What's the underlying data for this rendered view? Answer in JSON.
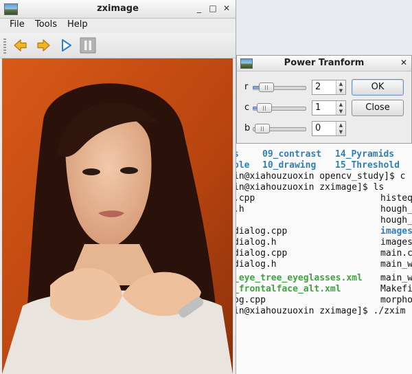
{
  "main_window": {
    "title": "zximage",
    "minimize_glyph": "_",
    "maximize_glyph": "□",
    "close_glyph": "✕",
    "menu": [
      "File",
      "Tools",
      "Help"
    ],
    "toolbar": [
      {
        "name": "back-arrow-icon",
        "color": "#e9a51b"
      },
      {
        "name": "forward-arrow-icon",
        "color": "#e9a51b"
      },
      {
        "name": "play-icon",
        "color": "#2a7fd0"
      },
      {
        "name": "pause-icon",
        "color": "#9a9a9a"
      }
    ]
  },
  "dialog": {
    "title": "Power Tranform",
    "close_glyph": "✕",
    "params": [
      {
        "label": "r",
        "value": "2"
      },
      {
        "label": "c",
        "value": "1"
      },
      {
        "label": "b",
        "value": "0"
      }
    ],
    "ok_label": "OK",
    "close_label": "Close"
  },
  "terminal": {
    "lines": [
      [
        {
          "text": "s",
          "color": "blue"
        },
        {
          "text": "09_contrast",
          "color": "blue"
        },
        {
          "text": "14_Pyramids",
          "color": "blue"
        }
      ],
      [
        {
          "text": "ole",
          "color": "blue"
        },
        {
          "text": "10_drawing",
          "color": "blue"
        },
        {
          "text": "15_Threshold",
          "color": "blue"
        }
      ],
      [
        {
          "text": "in@xiahouzuoxin opencv_study]$ c",
          "color": "plain"
        }
      ],
      [
        {
          "text": "in@xiahouzuoxin zximage]$ ls",
          "color": "plain"
        }
      ],
      [
        {
          "text": ".cpp",
          "color": "plain"
        },
        {
          "text": "histeq",
          "color": "plain"
        }
      ],
      [
        {
          "text": ".h",
          "color": "plain"
        },
        {
          "text": "hough_",
          "color": "plain"
        }
      ],
      [
        {
          "text": "hough_",
          "color": "plain"
        }
      ],
      [
        {
          "text": "dialog.cpp",
          "color": "plain"
        },
        {
          "text": "images",
          "color": "blue"
        }
      ],
      [
        {
          "text": "dialog.h",
          "color": "plain"
        },
        {
          "text": "images",
          "color": "plain"
        }
      ],
      [
        {
          "text": "dialog.cpp",
          "color": "plain"
        },
        {
          "text": "main.c",
          "color": "plain"
        }
      ],
      [
        {
          "text": "dialog.h",
          "color": "plain"
        },
        {
          "text": "main_w",
          "color": "plain"
        }
      ],
      [
        {
          "text": "_eye_tree_eyeglasses.xml",
          "color": "green"
        },
        {
          "text": "main_w",
          "color": "plain"
        }
      ],
      [
        {
          "text": "_frontalface_alt.xml",
          "color": "green"
        },
        {
          "text": "Makefi",
          "color": "plain"
        }
      ],
      [
        {
          "text": "og.cpp",
          "color": "plain"
        },
        {
          "text": "morpho",
          "color": "plain"
        }
      ],
      [
        {
          "text": "in@xiahouzuoxin zximage]$ ./zxim",
          "color": "plain"
        }
      ]
    ]
  }
}
